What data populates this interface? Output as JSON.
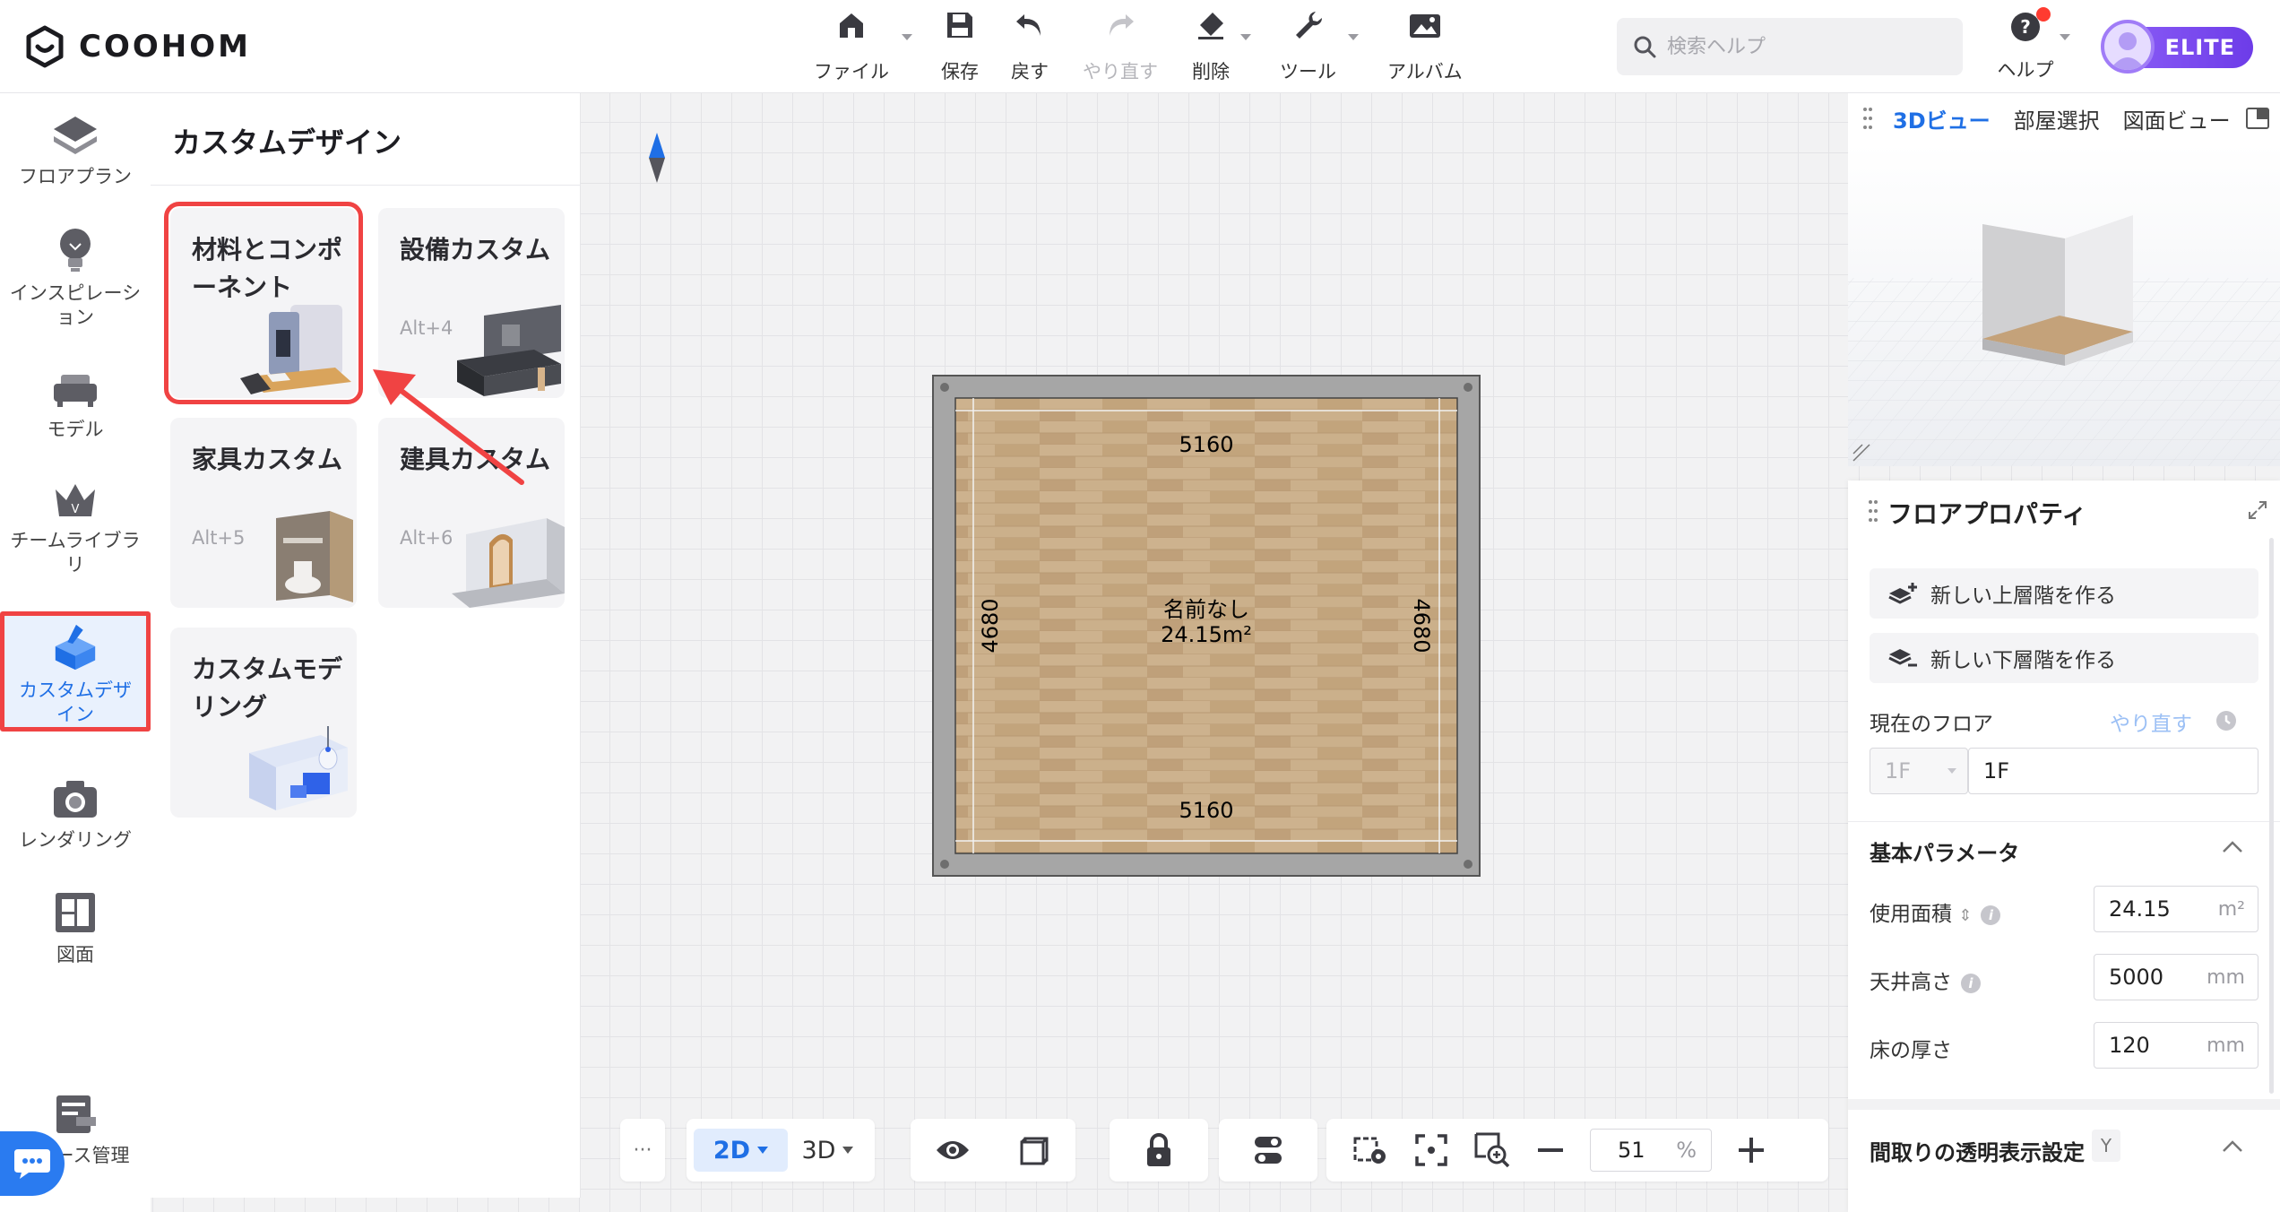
{
  "app": {
    "brand": "COOHOM"
  },
  "toolbar": {
    "file": "ファイル",
    "save": "保存",
    "undo": "戻す",
    "redo": "やり直す",
    "delete": "削除",
    "tools": "ツール",
    "album": "アルバム"
  },
  "search": {
    "placeholder": "検索ヘルプ"
  },
  "help": {
    "label": "ヘルプ"
  },
  "account": {
    "badge": "ELITE"
  },
  "leftnav": {
    "items": [
      {
        "label": "フロアプラン",
        "icon": "floorplan-icon"
      },
      {
        "label": "インスピレーション",
        "icon": "lightbulb-icon"
      },
      {
        "label": "モデル",
        "icon": "sofa-icon"
      },
      {
        "label": "チームライブラリ",
        "icon": "crown-icon"
      },
      {
        "label": "カスタムデザイン",
        "icon": "custom-design-icon"
      },
      {
        "label": "レンダリング",
        "icon": "camera-icon"
      },
      {
        "label": "図面",
        "icon": "drawing-icon"
      },
      {
        "label": "ース管理",
        "icon": "resource-icon"
      }
    ],
    "active": "カスタムデザイン"
  },
  "panel": {
    "title": "カスタムデザイン",
    "cards": [
      {
        "title": "材料とコンポーネント",
        "shortcut": ""
      },
      {
        "title": "設備カスタム",
        "shortcut": "Alt+4"
      },
      {
        "title": "家具カスタム",
        "shortcut": "Alt+5"
      },
      {
        "title": "建具カスタム",
        "shortcut": "Alt+6"
      },
      {
        "title": "カスタムモデリング",
        "shortcut": ""
      }
    ]
  },
  "canvas": {
    "room_name": "名前なし",
    "room_area": "24.15m²",
    "dim_top": "5160",
    "dim_bottom": "5160",
    "dim_left": "4680",
    "dim_right": "4680"
  },
  "viewpanel": {
    "tabs": [
      "3Dビュー",
      "部屋選択",
      "図面ビュー"
    ],
    "active_tab": "3Dビュー"
  },
  "properties": {
    "title": "フロアプロパティ",
    "add_upper": "新しい上層階を作る",
    "add_lower": "新しい下層階を作る",
    "current_floor_label": "現在のフロア",
    "redo": "やり直す",
    "floor_select": "1F",
    "floor_name": "1F",
    "basic_params": "基本パラメータ",
    "area_label": "使用面積",
    "area_value": "24.15",
    "area_unit": "m²",
    "ceiling_label": "天井高さ",
    "ceiling_value": "5000",
    "ceiling_unit": "mm",
    "floor_thickness_label": "床の厚さ",
    "floor_thickness_value": "120",
    "floor_thickness_unit": "mm",
    "transparency_label": "間取りの透明表示設定",
    "transparency_shortcut": "Y"
  },
  "bottombar": {
    "more": "···",
    "view2d": "2D",
    "view3d": "3D",
    "zoom_value": "51",
    "zoom_unit": "%"
  },
  "colors": {
    "accent": "#1f6fe5",
    "highlight": "#f04343",
    "elite": "#7a4af0",
    "wall": "#a6a6a6",
    "floor": "#c9ad87"
  }
}
